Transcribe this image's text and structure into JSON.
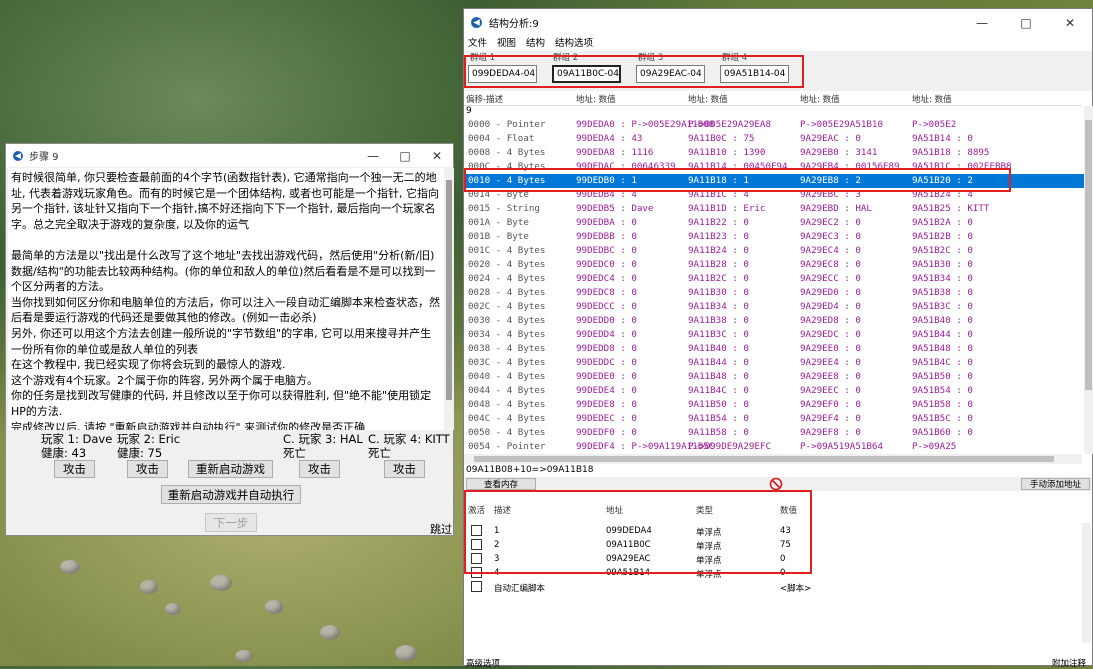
{
  "step_window": {
    "title": "步骤 9",
    "tutorial_text": "有时候很简单, 你只要检查最前面的4个字节(函数指针表), 它通常指向一个独一无二的地址, 代表着游戏玩家角色。而有的时候它是一个团体结构, 或者也可能是一个指针, 它指向另一个指针, 该址针又指向下一个指针,搞不好还指向下下一个指针, 最后指向一个玩家名字。总之完全取决于游戏的复杂度, 以及你的运气\n\n最简单的方法是以\"找出是什么改写了这个地址\"去找出游戏代码，然后使用\"分析(新/旧)数据/结构\"的功能去比较两种结构。(你的单位和敌人的单位)然后看看是不是可以找到一个区分两者的方法。\n当你找到如何区分你和电脑单位的方法后，你可以注入一段自动汇编脚本来检查状态，然后看是要运行游戏的代码还是要做其他的修改。(例如一击必杀)\n另外, 你还可以用这个方法去创建一般所说的\"字节数组\"的字串, 它可以用来搜寻并产生一份所有你的单位或是敌人单位的列表\n在这个教程中, 我已经实现了你将会玩到的最惊人的游戏.\n这个游戏有4个玩家。2个属于你的阵容, 另外两个属于电脑方。\n你的任务是找到改写健康的代码, 并且修改以至于你可以获得胜利, 但\"绝不能\"使用锁定HP的方法.\n完成修改以后, 请按 \"重新启动游戏并自动执行\" 来测试你的修改是否正确",
    "players": [
      {
        "name": "玩家 1: Dave",
        "status": "健康: 43",
        "attack": "攻击"
      },
      {
        "name": "玩家 2: Eric",
        "status": "健康: 75",
        "attack": "攻击"
      },
      {
        "name": "C. 玩家 3: HAL",
        "status": "死亡",
        "attack": "攻击"
      },
      {
        "name": "C. 玩家 4: KITT",
        "status": "死亡",
        "attack": "攻击"
      }
    ],
    "restart_label": "重新启动游戏",
    "restart_auto_label": "重新启动游戏并自动执行",
    "next_label": "下一步",
    "skip_label": "跳过"
  },
  "ce_window": {
    "title": "结构分析:9",
    "menu": [
      "文件",
      "视图",
      "结构",
      "结构选项"
    ],
    "groups": [
      {
        "label": "群组 1",
        "value": "099DEDA4-04"
      },
      {
        "label": "群组 2",
        "value": "09A11B0C-04"
      },
      {
        "label": "群组 3",
        "value": "09A29EAC-04"
      },
      {
        "label": "群组 4",
        "value": "09A51B14-04"
      }
    ],
    "headers": [
      "偏移-描述",
      "地址: 数值",
      "地址: 数值",
      "地址: 数值",
      "地址: 数值"
    ],
    "count": "9",
    "rows": [
      {
        "name": "0000 - Pointer",
        "c": [
          "99DEDA0 : P->005E29A11B08",
          "P->005E29A29EA8",
          "P->005E29A51B10",
          "P->005E2"
        ]
      },
      {
        "name": "0004 - Float",
        "c": [
          "99DEDA4 : 43",
          "9A11B0C : 75",
          "9A29EAC : 0",
          "9A51B14 : 0"
        ]
      },
      {
        "name": "0008 - 4 Bytes",
        "c": [
          "99DEDA8 : 1116",
          "9A11B10 : 1390",
          "9A29EB0 : 3141",
          "9A51B18 : 8895"
        ]
      },
      {
        "name": "000C - 4 Bytes",
        "c": [
          "99DEDAC : 00646339",
          "9A11B14 : 00450F94",
          "9A29EB4 : 00156E89",
          "9A51B1C : 002EEBB8"
        ]
      },
      {
        "name": "0010 - 4 Bytes",
        "c": [
          "99DEDB0 : 1",
          "9A11B18 : 1",
          "9A29EB8 : 2",
          "9A51B20 : 2"
        ],
        "selected": true
      },
      {
        "name": "0014 - Byte",
        "c": [
          "99DEDB4 : 4",
          "9A11B1C : 4",
          "9A29EBC : 3",
          "9A51B24 : 4"
        ]
      },
      {
        "name": "0015 - String",
        "c": [
          "99DEDB5 : Dave",
          "9A11B1D : Eric",
          "9A29EBD : HAL",
          "9A51B25 : KITT"
        ]
      },
      {
        "name": "001A - Byte",
        "c": [
          "99DEDBA : 0",
          "9A11B22 : 0",
          "9A29EC2 : 0",
          "9A51B2A : 0"
        ]
      },
      {
        "name": "001B - Byte",
        "c": [
          "99DEDBB : 0",
          "9A11B23 : 0",
          "9A29EC3 : 0",
          "9A51B2B : 0"
        ]
      },
      {
        "name": "001C - 4 Bytes",
        "c": [
          "99DEDBC : 0",
          "9A11B24 : 0",
          "9A29EC4 : 0",
          "9A51B2C : 0"
        ]
      },
      {
        "name": "0020 - 4 Bytes",
        "c": [
          "99DEDC0 : 0",
          "9A11B28 : 0",
          "9A29EC8 : 0",
          "9A51B30 : 0"
        ]
      },
      {
        "name": "0024 - 4 Bytes",
        "c": [
          "99DEDC4 : 0",
          "9A11B2C : 0",
          "9A29ECC : 0",
          "9A51B34 : 0"
        ]
      },
      {
        "name": "0028 - 4 Bytes",
        "c": [
          "99DEDC8 : 0",
          "9A11B30 : 0",
          "9A29ED0 : 0",
          "9A51B38 : 0"
        ]
      },
      {
        "name": "002C - 4 Bytes",
        "c": [
          "99DEDCC : 0",
          "9A11B34 : 0",
          "9A29ED4 : 0",
          "9A51B3C : 0"
        ]
      },
      {
        "name": "0030 - 4 Bytes",
        "c": [
          "99DEDD0 : 0",
          "9A11B38 : 0",
          "9A29ED8 : 0",
          "9A51B40 : 0"
        ]
      },
      {
        "name": "0034 - 4 Bytes",
        "c": [
          "99DEDD4 : 0",
          "9A11B3C : 0",
          "9A29EDC : 0",
          "9A51B44 : 0"
        ]
      },
      {
        "name": "0038 - 4 Bytes",
        "c": [
          "99DEDD8 : 0",
          "9A11B40 : 0",
          "9A29EE0 : 0",
          "9A51B48 : 0"
        ]
      },
      {
        "name": "003C - 4 Bytes",
        "c": [
          "99DEDDC : 0",
          "9A11B44 : 0",
          "9A29EE4 : 0",
          "9A51B4C : 0"
        ]
      },
      {
        "name": "0040 - 4 Bytes",
        "c": [
          "99DEDE0 : 0",
          "9A11B48 : 0",
          "9A29EE8 : 0",
          "9A51B50 : 0"
        ]
      },
      {
        "name": "0044 - 4 Bytes",
        "c": [
          "99DEDE4 : 0",
          "9A11B4C : 0",
          "9A29EEC : 0",
          "9A51B54 : 0"
        ]
      },
      {
        "name": "0048 - 4 Bytes",
        "c": [
          "99DEDE8 : 0",
          "9A11B50 : 0",
          "9A29EF0 : 0",
          "9A51B58 : 0"
        ]
      },
      {
        "name": "004C - 4 Bytes",
        "c": [
          "99DEDEC : 0",
          "9A11B54 : 0",
          "9A29EF4 : 0",
          "9A51B5C : 0"
        ]
      },
      {
        "name": "0050 - 4 Bytes",
        "c": [
          "99DEDF0 : 0",
          "9A11B58 : 0",
          "9A29EF8 : 0",
          "9A51B60 : 0"
        ]
      },
      {
        "name": "0054 - Pointer",
        "c": [
          "99DEDF4 : P->09A119A11B5C",
          "P->099DE9A29EFC",
          "P->09A519A51B64",
          "P->09A25"
        ]
      }
    ],
    "status": "09A11B08+10=>09A11B18",
    "view_memory_label": "查看内存",
    "add_manual_label": "手动添加地址",
    "table_headers": [
      "激活",
      "描述",
      "地址",
      "类型",
      "数值"
    ],
    "table_rows": [
      {
        "desc": "1",
        "addr": "099DEDA4",
        "type": "单浮点",
        "value": "43"
      },
      {
        "desc": "2",
        "addr": "09A11B0C",
        "type": "单浮点",
        "value": "75"
      },
      {
        "desc": "3",
        "addr": "09A29EAC",
        "type": "单浮点",
        "value": "0"
      },
      {
        "desc": "4",
        "addr": "09A51B14",
        "type": "单浮点",
        "value": "0"
      }
    ],
    "script_row": {
      "desc": "自动汇编脚本",
      "value": "<脚本>"
    },
    "advanced_label": "高级选项",
    "comment_label": "附加注释"
  },
  "colors": {
    "selection": "#0078d7",
    "highlight": "#e02020",
    "value_text": "#9b1f9b"
  }
}
